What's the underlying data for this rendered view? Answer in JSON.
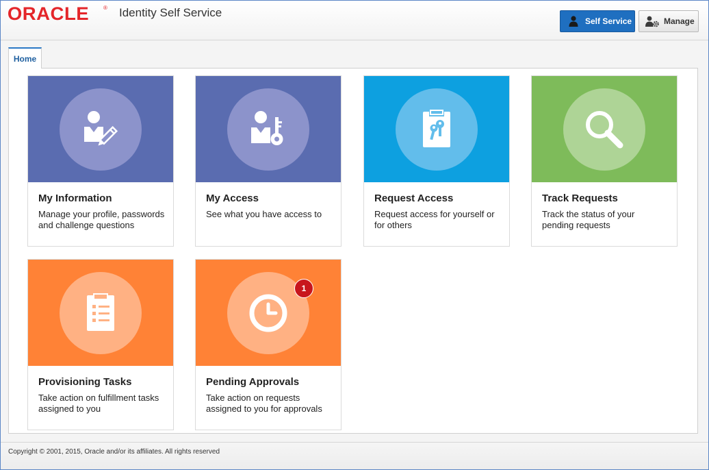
{
  "header": {
    "logo_text": "ORACLE",
    "logo_reg": "®",
    "app_title": "Identity Self Service",
    "self_service_label": "Self Service",
    "manage_label": "Manage"
  },
  "tabs": [
    {
      "label": "Home",
      "active": true
    }
  ],
  "tiles": [
    {
      "title": "My Information",
      "description": "Manage your profile, passwords and challenge questions",
      "color": "#5a6cb0",
      "circle_color": "#8c93cb",
      "icon": "user-edit-icon"
    },
    {
      "title": "My Access",
      "description": "See what you have access to",
      "color": "#5a6cb0",
      "circle_color": "#8c93cb",
      "icon": "user-key-icon"
    },
    {
      "title": "Request Access",
      "description": "Request access for yourself or for others",
      "color": "#0da0e0",
      "circle_color": "#62bdeb",
      "icon": "key-badge-icon"
    },
    {
      "title": "Track Requests",
      "description": "Track the status of your pending requests",
      "color": "#7ebb5a",
      "circle_color": "#aed496",
      "icon": "magnifier-icon"
    },
    {
      "title": "Provisioning Tasks",
      "description": "Take action on fulfillment tasks assigned to you",
      "color": "#ff8236",
      "circle_color": "#ffb183",
      "icon": "clipboard-list-icon"
    },
    {
      "title": "Pending Approvals",
      "description": "Take action on requests assigned to you for approvals",
      "color": "#ff8236",
      "circle_color": "#ffb183",
      "icon": "clock-icon",
      "badge": "1"
    }
  ],
  "footer": {
    "copyright": "Copyright © 2001, 2015, Oracle and/or its affiliates. All rights reserved"
  }
}
